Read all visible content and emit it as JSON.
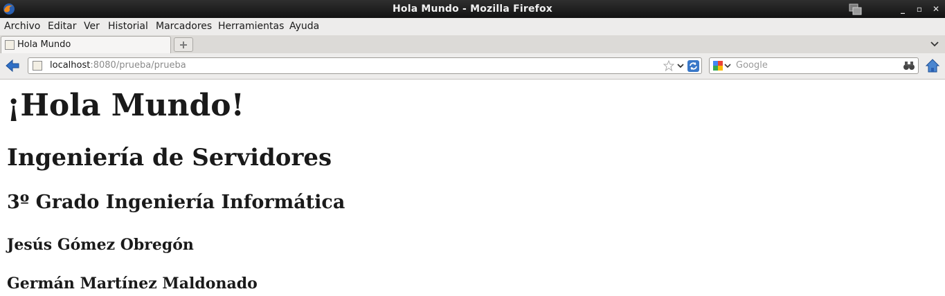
{
  "window": {
    "title": "Hola Mundo - Mozilla Firefox",
    "controls": [
      "minimize",
      "maximize",
      "close"
    ]
  },
  "menu": [
    {
      "label": "Archivo"
    },
    {
      "label": "Editar"
    },
    {
      "label": "Ver"
    },
    {
      "label": "Historial"
    },
    {
      "label": "Marcadores"
    },
    {
      "label": "Herramientas"
    },
    {
      "label": "Ayuda"
    }
  ],
  "tabs": [
    {
      "label": "Hola Mundo",
      "active": true
    }
  ],
  "address": {
    "host": "localhost",
    "path": ":8080/prueba/prueba"
  },
  "search": {
    "engine": "Google",
    "placeholder": "Google"
  },
  "page": {
    "heading1": "¡Hola Mundo!",
    "heading2": "Ingeniería de Servidores",
    "heading3": "3º Grado Ingeniería Informática",
    "author1": "Jesús Gómez Obregón",
    "author2": "Germán Martínez Maldonado"
  },
  "colors": {
    "titlebar": "#1e1e1e",
    "toolbar": "#edeceb",
    "accent_blue": "#2f6fc6"
  }
}
